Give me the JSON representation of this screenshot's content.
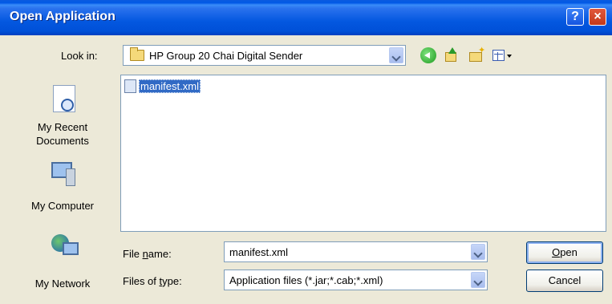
{
  "window": {
    "title": "Open Application",
    "help_label": "?",
    "close_label": "×"
  },
  "lookin": {
    "label": "Look in:",
    "value": "HP Group 20 Chai Digital Sender",
    "folder_icon": "folder-icon"
  },
  "toolbar": {
    "icons": [
      "back-icon",
      "up-folder-icon",
      "new-folder-icon",
      "views-menu-icon"
    ]
  },
  "places": {
    "recent_line1": "My Recent",
    "recent_line2": "Documents",
    "computer": "My Computer",
    "network": "My Network"
  },
  "files": [
    {
      "name": "manifest.xml",
      "icon": "xml-file-icon",
      "selected": true
    }
  ],
  "filename": {
    "label": "File name:",
    "value": "manifest.xml"
  },
  "filetype": {
    "label": "Files of type:",
    "value": "Application files (*.jar;*.cab;*.xml)"
  },
  "buttons": {
    "open": "Open",
    "cancel": "Cancel"
  }
}
